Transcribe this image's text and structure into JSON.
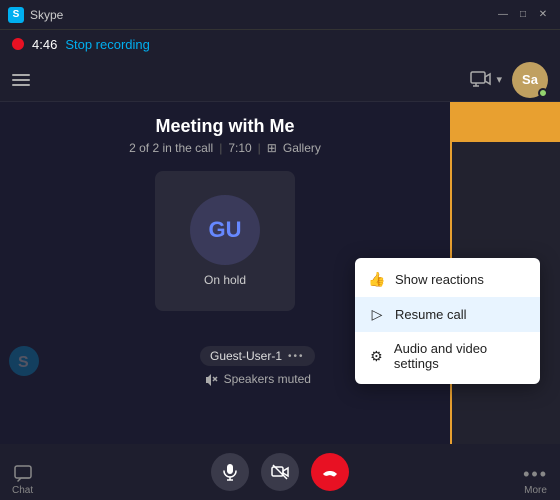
{
  "titlebar": {
    "icon": "S",
    "title": "Skype",
    "minimize": "—",
    "maximize": "□",
    "close": "✕"
  },
  "recording": {
    "time": "4:46",
    "stop_label": "Stop recording"
  },
  "topnav": {
    "camera_icon": "📹",
    "avatar_initials": "Sa"
  },
  "call": {
    "title": "Meeting with Me",
    "info": "2 of 2 in the call",
    "duration": "7:10",
    "view": "Gallery"
  },
  "user_tile": {
    "initials": "GU",
    "status": "On hold"
  },
  "guest_label": {
    "name": "Guest-User-1",
    "dots": "•••"
  },
  "speaker_muted": "Speakers muted",
  "context_menu": {
    "items": [
      {
        "icon": "👍",
        "label": "Show reactions"
      },
      {
        "icon": "▷",
        "label": "Resume call",
        "highlighted": true
      },
      {
        "icon": "⚙",
        "label": "Audio and video settings"
      }
    ]
  },
  "bottom_controls": {
    "mic_icon": "🎤",
    "video_icon": "📷",
    "hangup_icon": "📞",
    "more_dots": "•••"
  },
  "nav": {
    "chat_label": "Chat",
    "more_label": "More"
  }
}
